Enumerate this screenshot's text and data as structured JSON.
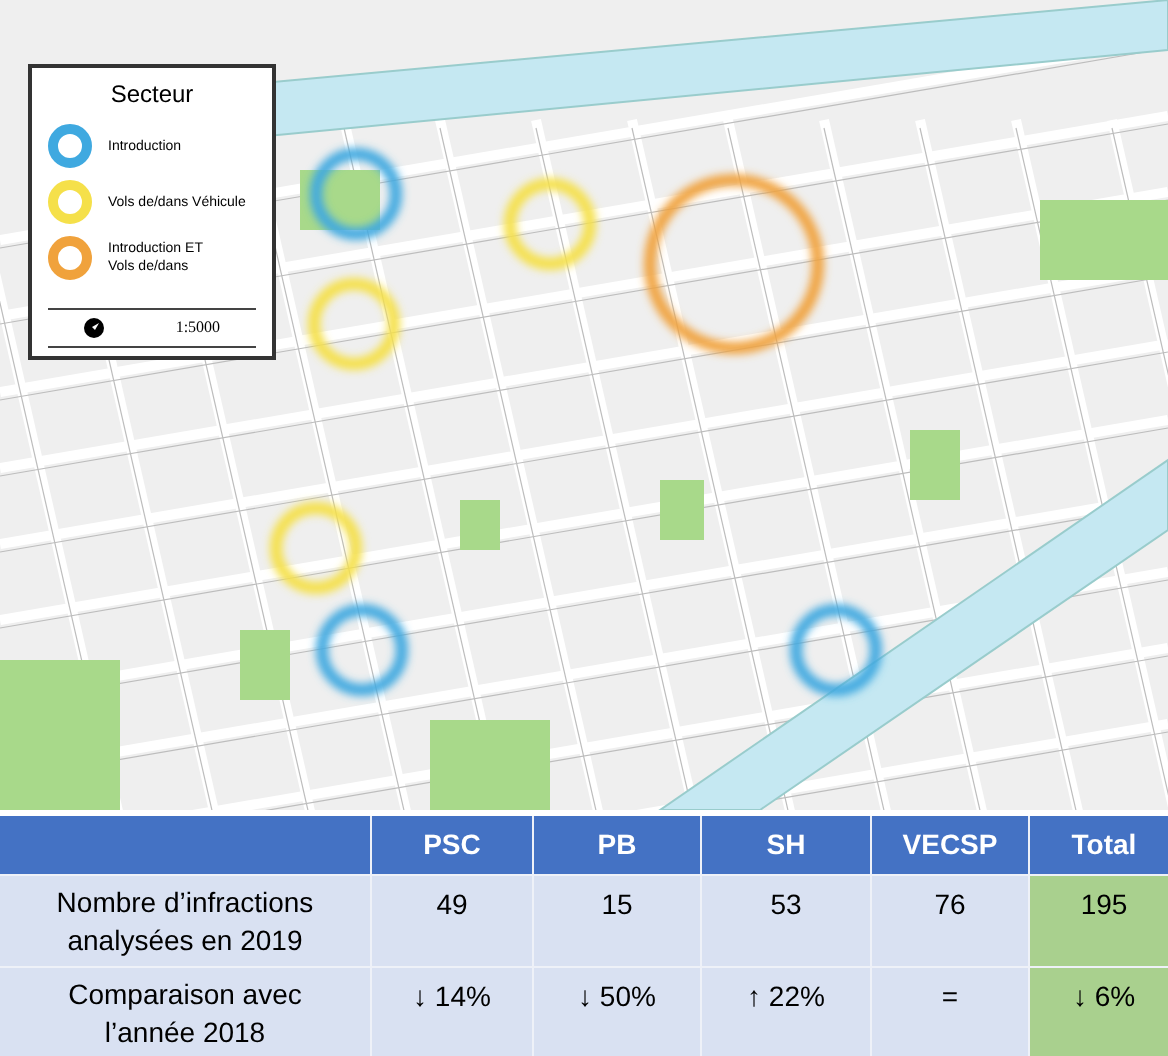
{
  "legend": {
    "title": "Secteur",
    "items": [
      {
        "label": "Introduction",
        "color": "#3fa9e0"
      },
      {
        "label": "Vols de/dans Véhicule",
        "color": "#f5e04a"
      },
      {
        "label": "Introduction ET\nVols de/dans",
        "color": "#f0a23c"
      }
    ],
    "scale": "1:5000"
  },
  "table": {
    "columns": [
      "PSC",
      "PB",
      "SH",
      "VECSP",
      "Total"
    ],
    "rows": [
      {
        "label": "Nombre d’infractions analysées en 2019",
        "cells": [
          "49",
          "15",
          "53",
          "76",
          "195"
        ]
      },
      {
        "label": "Comparaison avec l’année 2018",
        "cells": [
          "↓ 14%",
          "↓ 50%",
          "↑ 22%",
          "=",
          "↓ 6%"
        ]
      }
    ]
  }
}
